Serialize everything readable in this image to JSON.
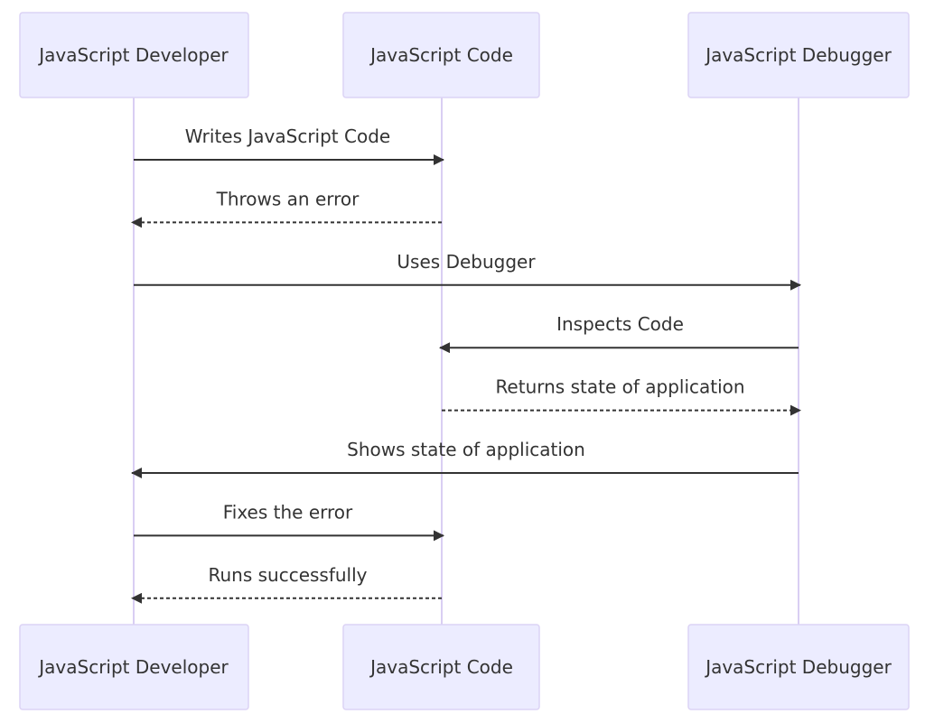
{
  "participants": [
    {
      "label": "JavaScript Developer"
    },
    {
      "label": "JavaScript Code"
    },
    {
      "label": "JavaScript Debugger"
    }
  ],
  "messages": [
    {
      "from": 0,
      "to": 1,
      "label": "Writes JavaScript Code",
      "style": "solid"
    },
    {
      "from": 1,
      "to": 0,
      "label": "Throws an error",
      "style": "dashed"
    },
    {
      "from": 0,
      "to": 2,
      "label": "Uses Debugger",
      "style": "solid"
    },
    {
      "from": 2,
      "to": 1,
      "label": "Inspects Code",
      "style": "solid"
    },
    {
      "from": 1,
      "to": 2,
      "label": "Returns state of application",
      "style": "dashed"
    },
    {
      "from": 2,
      "to": 0,
      "label": "Shows state of application",
      "style": "solid"
    },
    {
      "from": 0,
      "to": 1,
      "label": "Fixes the error",
      "style": "solid"
    },
    {
      "from": 1,
      "to": 0,
      "label": "Runs successfully",
      "style": "dashed"
    }
  ],
  "colors": {
    "actor_fill": "#ECECFF",
    "actor_stroke": "#DCD3F5",
    "lifeline": "#D9CEF3",
    "arrow": "#333333",
    "text": "#333333"
  }
}
